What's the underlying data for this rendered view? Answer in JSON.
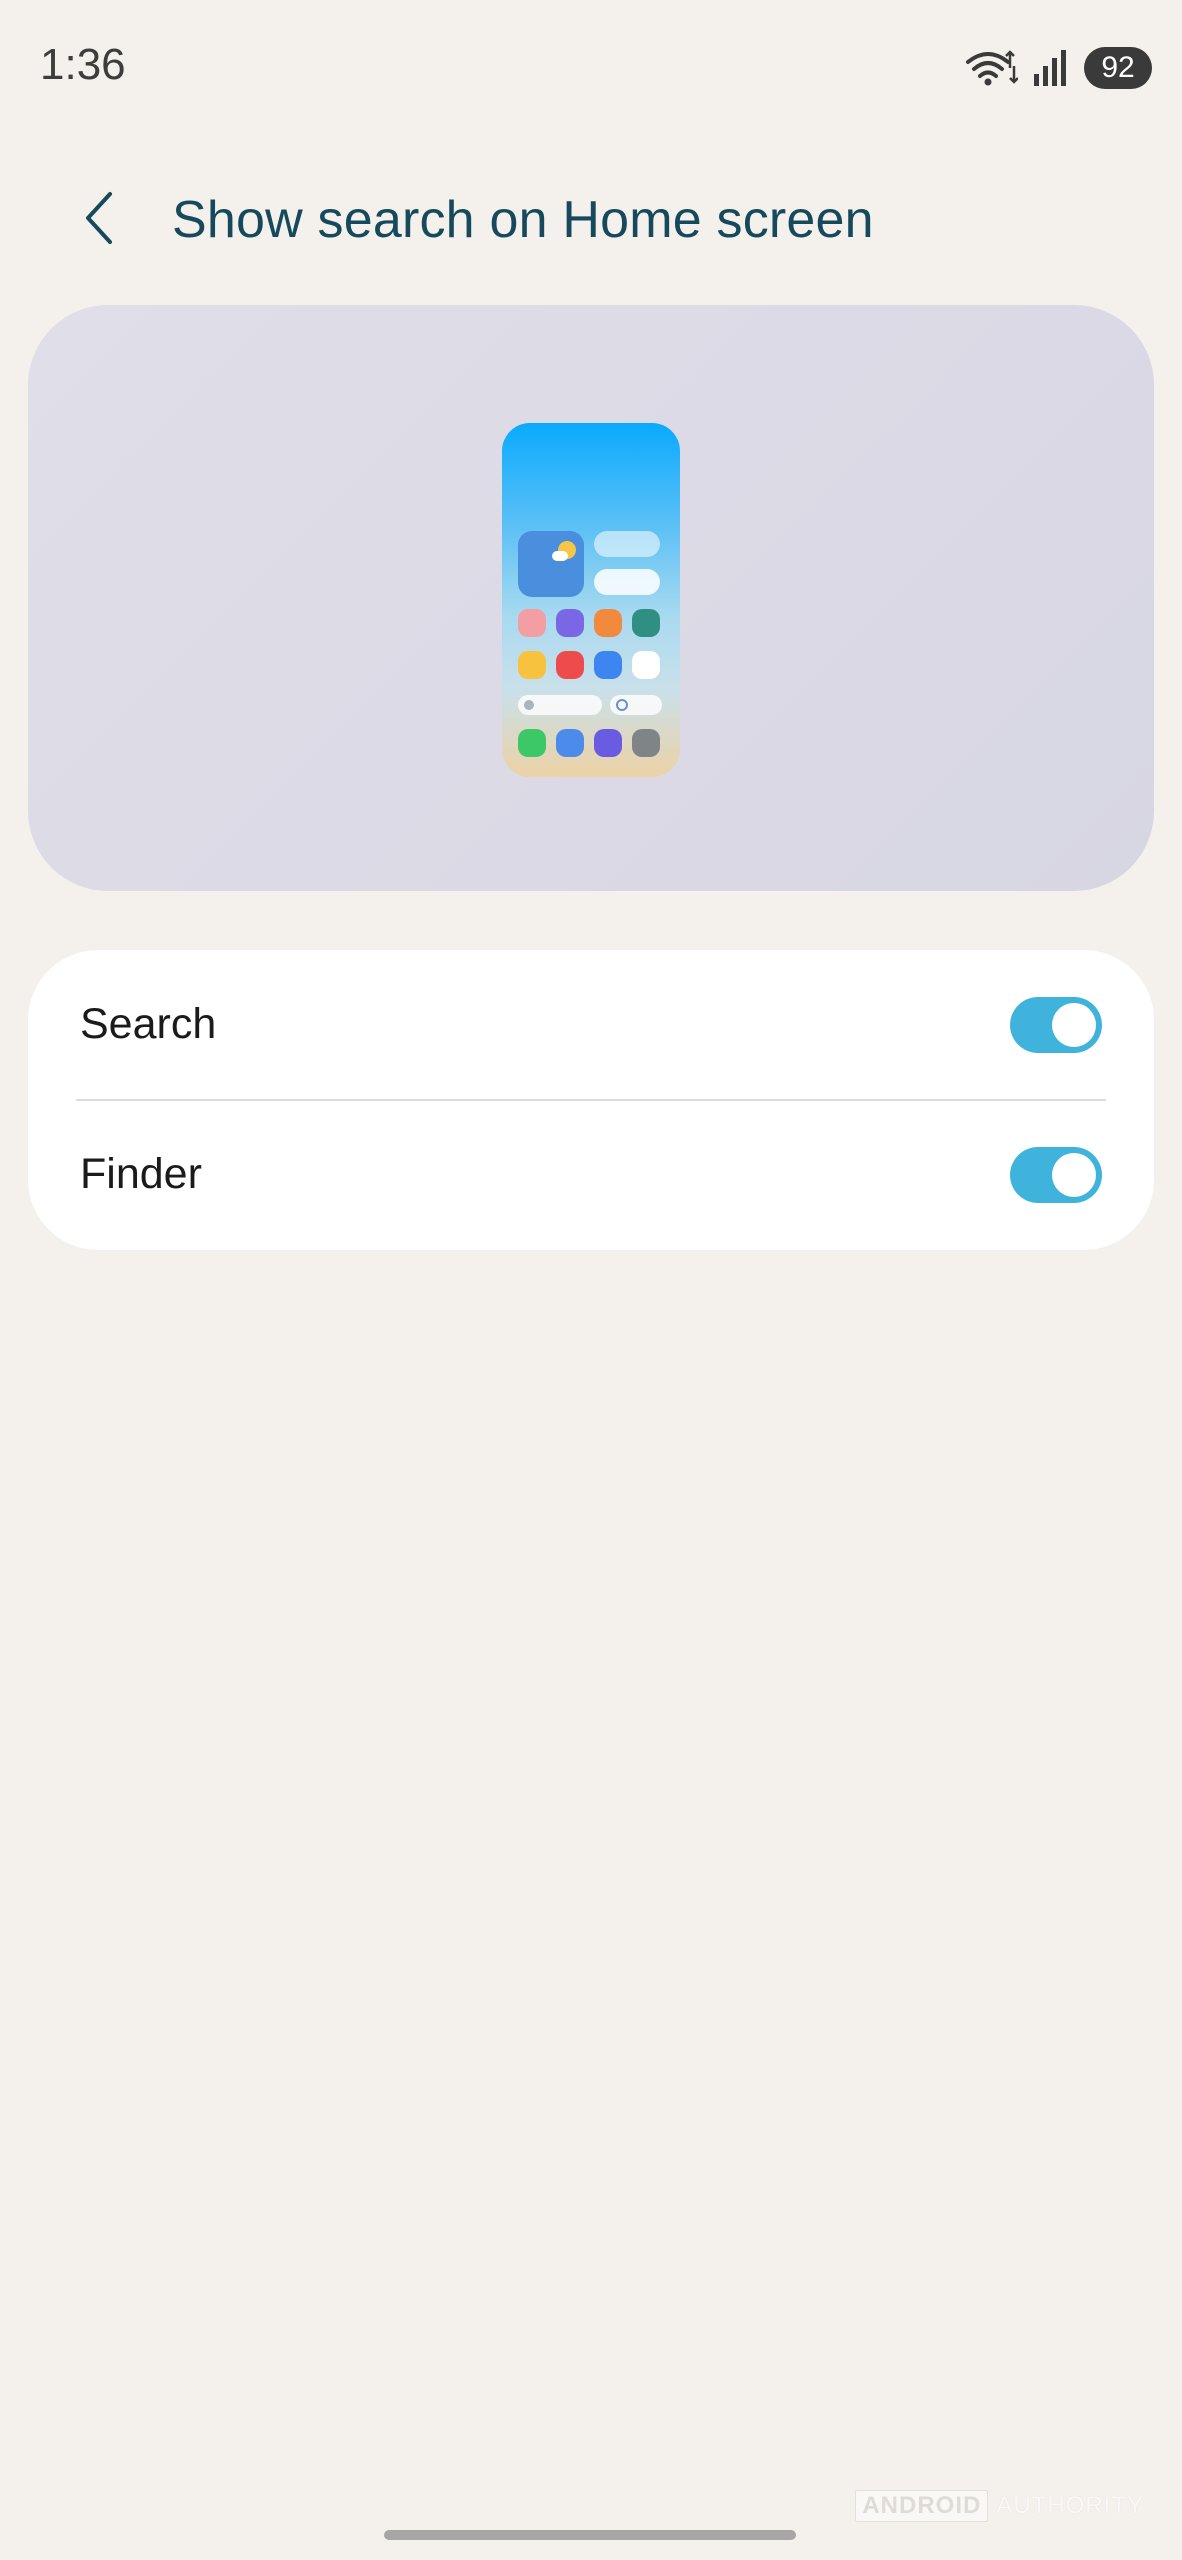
{
  "status_bar": {
    "time": "1:36",
    "battery": "92",
    "icons": [
      "wifi-icon",
      "signal-icon",
      "battery-icon"
    ]
  },
  "header": {
    "back_icon": "chevron-left-icon",
    "title": "Show search on Home screen"
  },
  "preview": {
    "description_icon": "phone-home-screen-illustration",
    "app_icon_colors": [
      [
        "#f29ea3",
        "#7a67e6",
        "#f18a3d",
        "#2f8f83"
      ],
      [
        "#f7c23e",
        "#ee4c4c",
        "#3e86ef",
        "#ffffff"
      ],
      [
        "#3dc867",
        "#4c8bea",
        "#6a5ce2",
        "#7f8487"
      ]
    ]
  },
  "settings": {
    "items": [
      {
        "label": "Search",
        "enabled": true
      },
      {
        "label": "Finder",
        "enabled": true
      }
    ]
  },
  "colors": {
    "background": "#f4f0ec",
    "title": "#16495c",
    "toggle_on": "#3fb3db"
  },
  "watermark": {
    "brand_box": "ANDROID",
    "brand_text": "AUTHORITY"
  }
}
